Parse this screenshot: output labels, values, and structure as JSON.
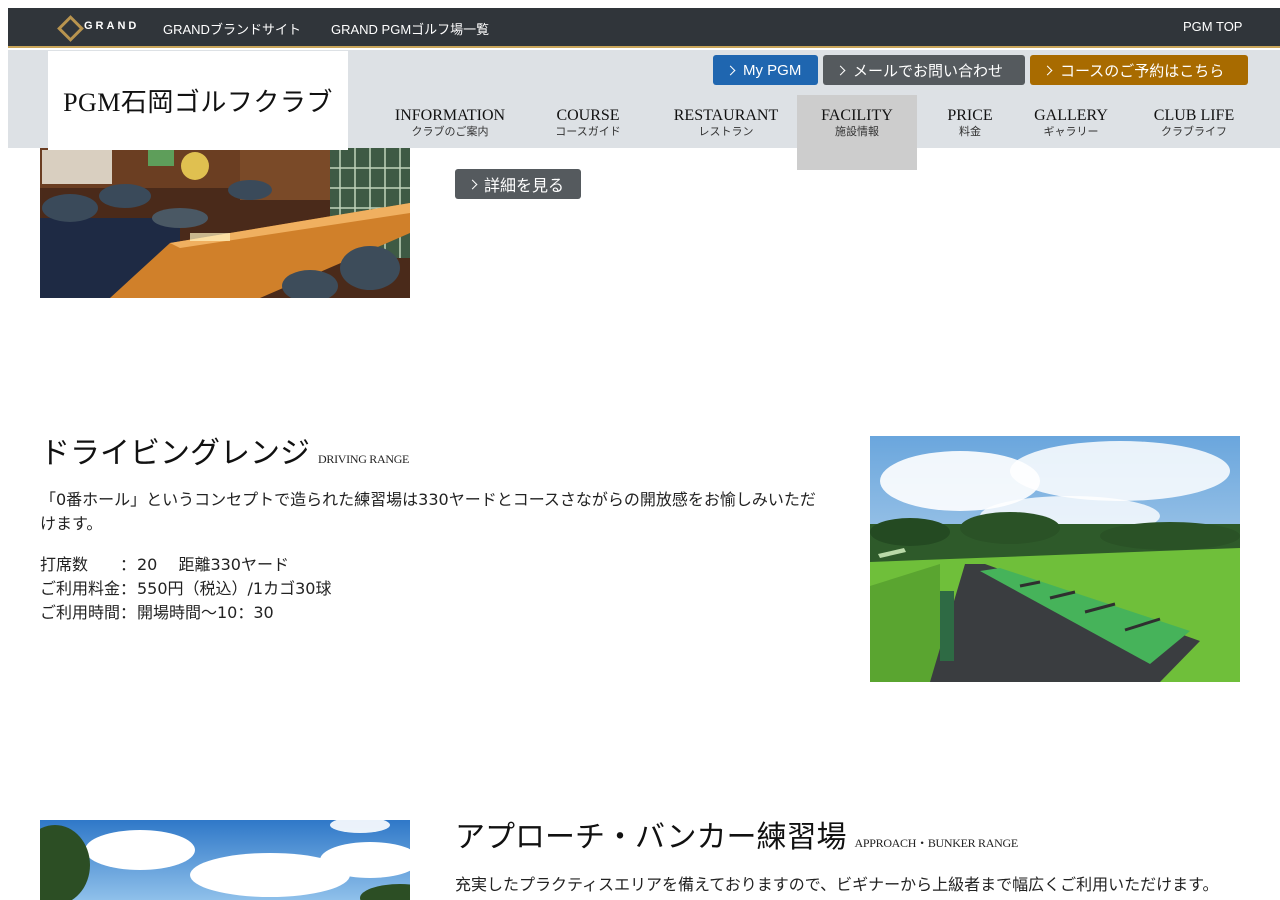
{
  "topbar": {
    "logo_text": "GRAND",
    "links": [
      "GRANDブランドサイト",
      "GRAND PGMゴルフ場一覧"
    ],
    "right_link": "PGM TOP"
  },
  "brand": {
    "name": "PGM石岡ゴルフクラブ"
  },
  "header_buttons": {
    "mypgm": "My PGM",
    "mail": "メールでお問い合わせ",
    "reserve": "コースのご予約はこちら"
  },
  "nav": [
    {
      "en": "INFORMATION",
      "ja": "クラブのご案内"
    },
    {
      "en": "COURSE",
      "ja": "コースガイド"
    },
    {
      "en": "RESTAURANT",
      "ja": "レストラン"
    },
    {
      "en": "FACILITY",
      "ja": "施設情報"
    },
    {
      "en": "PRICE",
      "ja": "料金"
    },
    {
      "en": "GALLERY",
      "ja": "ギャラリー"
    },
    {
      "en": "CLUB LIFE",
      "ja": "クラブライフ"
    }
  ],
  "active_nav": "FACILITY",
  "lounge": {
    "detail_label": "詳細を見る"
  },
  "driving_range": {
    "title": "ドライビングレンジ",
    "title_en": "DRIVING RANGE",
    "description": "「0番ホール」というコンセプトで造られた練習場は330ヤードとコースさながらの開放感をお愉しみいただけます。",
    "specs": [
      {
        "label": "打席数　　：",
        "value": "20　 距離330ヤード"
      },
      {
        "label": "ご利用料金：",
        "value": "550円（税込）/1カゴ30球"
      },
      {
        "label": "ご利用時間：",
        "value": "開場時間～10：30"
      }
    ]
  },
  "approach": {
    "title": "アプローチ・バンカー練習場",
    "title_en": "APPROACH・BUNKER RANGE",
    "description": "充実したプラクティスエリアを備えておりますので、ビギナーから上級者まで幅広くご利用いただけます。"
  },
  "colors": {
    "topbar": "#30353a",
    "header": "#dde1e5",
    "mypgm": "#1f66b0",
    "gray_button": "#555a5e",
    "reserve": "#a86b00",
    "active_nav": "#cdcdcd"
  }
}
